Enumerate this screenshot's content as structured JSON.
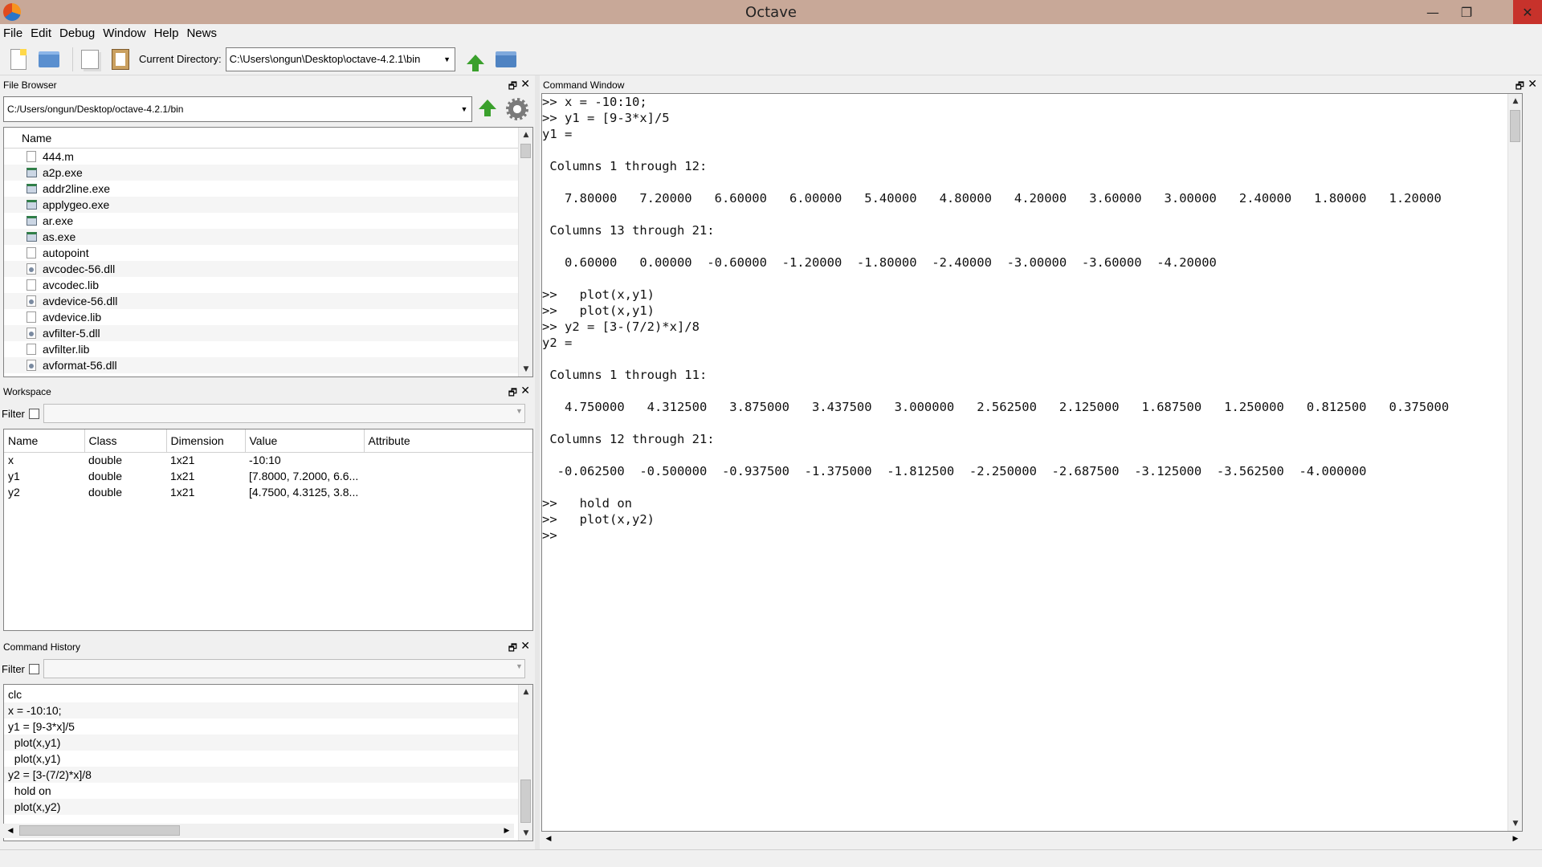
{
  "window": {
    "title": "Octave",
    "minimize": "—",
    "maximize": "❐",
    "close": "✕"
  },
  "menu": [
    "File",
    "Edit",
    "Debug",
    "Window",
    "Help",
    "News"
  ],
  "toolbar": {
    "current_directory_label": "Current Directory:",
    "current_directory": "C:\\Users\\ongun\\Desktop\\octave-4.2.1\\bin"
  },
  "file_browser": {
    "title": "File Browser",
    "path": "C:/Users/ongun/Desktop/octave-4.2.1/bin",
    "column": "Name",
    "files": [
      {
        "name": "444.m",
        "icon": "file-icon"
      },
      {
        "name": "a2p.exe",
        "icon": "exe-icon"
      },
      {
        "name": "addr2line.exe",
        "icon": "exe-icon"
      },
      {
        "name": "applygeo.exe",
        "icon": "exe-icon"
      },
      {
        "name": "ar.exe",
        "icon": "exe-icon"
      },
      {
        "name": "as.exe",
        "icon": "exe-icon"
      },
      {
        "name": "autopoint",
        "icon": "file-icon"
      },
      {
        "name": "avcodec-56.dll",
        "icon": "dll-icon"
      },
      {
        "name": "avcodec.lib",
        "icon": "file-icon"
      },
      {
        "name": "avdevice-56.dll",
        "icon": "dll-icon"
      },
      {
        "name": "avdevice.lib",
        "icon": "file-icon"
      },
      {
        "name": "avfilter-5.dll",
        "icon": "dll-icon"
      },
      {
        "name": "avfilter.lib",
        "icon": "file-icon"
      },
      {
        "name": "avformat-56.dll",
        "icon": "dll-icon"
      }
    ]
  },
  "workspace": {
    "title": "Workspace",
    "filter_label": "Filter",
    "columns": [
      "Name",
      "Class",
      "Dimension",
      "Value",
      "Attribute"
    ],
    "rows": [
      [
        "x",
        "double",
        "1x21",
        "-10:10",
        ""
      ],
      [
        "y1",
        "double",
        "1x21",
        "[7.8000, 7.2000, 6.6...",
        ""
      ],
      [
        "y2",
        "double",
        "1x21",
        "[4.7500, 4.3125, 3.8...",
        ""
      ]
    ]
  },
  "command_history": {
    "title": "Command History",
    "filter_label": "Filter",
    "entries": [
      "clc",
      "x = -10:10;",
      "y1 = [9-3*x]/5",
      "  plot(x,y1)",
      "  plot(x,y1)",
      "y2 = [3-(7/2)*x]/8",
      "  hold on",
      "  plot(x,y2)"
    ]
  },
  "command_window": {
    "title": "Command Window",
    "lines": [
      ">> x = -10:10;",
      ">> y1 = [9-3*x]/5",
      "y1 =",
      "",
      " Columns 1 through 12:",
      "",
      "   7.80000   7.20000   6.60000   6.00000   5.40000   4.80000   4.20000   3.60000   3.00000   2.40000   1.80000   1.20000",
      "",
      " Columns 13 through 21:",
      "",
      "   0.60000   0.00000  -0.60000  -1.20000  -1.80000  -2.40000  -3.00000  -3.60000  -4.20000",
      "",
      ">>   plot(x,y1)",
      ">>   plot(x,y1)",
      ">> y2 = [3-(7/2)*x]/8",
      "y2 =",
      "",
      " Columns 1 through 11:",
      "",
      "   4.750000   4.312500   3.875000   3.437500   3.000000   2.562500   2.125000   1.687500   1.250000   0.812500   0.375000",
      "",
      " Columns 12 through 21:",
      "",
      "  -0.062500  -0.500000  -0.937500  -1.375000  -1.812500  -2.250000  -2.687500  -3.125000  -3.562500  -4.000000",
      "",
      ">>   hold on",
      ">>   plot(x,y2)",
      ">>"
    ]
  }
}
